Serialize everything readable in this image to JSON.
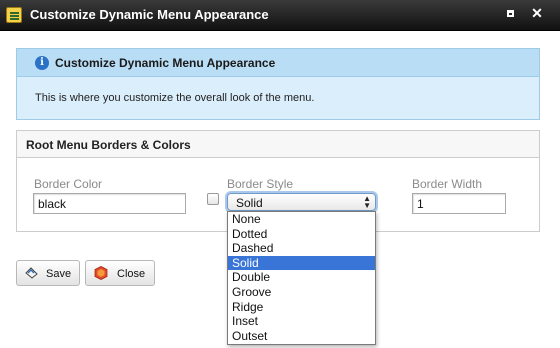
{
  "window": {
    "title": "Customize Dynamic Menu Appearance",
    "maximize_icon": "maximize-icon",
    "close_icon": "close-x-icon"
  },
  "info": {
    "icon": "info-icon",
    "title": "Customize Dynamic Menu Appearance",
    "description": "This is where you customize the overall look of the menu."
  },
  "panel": {
    "title": "Root Menu Borders & Colors",
    "border_color": {
      "label": "Border Color",
      "value": "black"
    },
    "border_style": {
      "label": "Border Style",
      "selected": "Solid",
      "options": [
        "None",
        "Dotted",
        "Dashed",
        "Solid",
        "Double",
        "Groove",
        "Ridge",
        "Inset",
        "Outset"
      ],
      "selected_index": 3
    },
    "border_width": {
      "label": "Border Width",
      "value": "1"
    }
  },
  "buttons": {
    "save_label": "Save",
    "close_label": "Close"
  },
  "colors": {
    "titlebar": "#1f1f1f",
    "info_header": "#b9ddf5",
    "selection": "#3875d7"
  }
}
